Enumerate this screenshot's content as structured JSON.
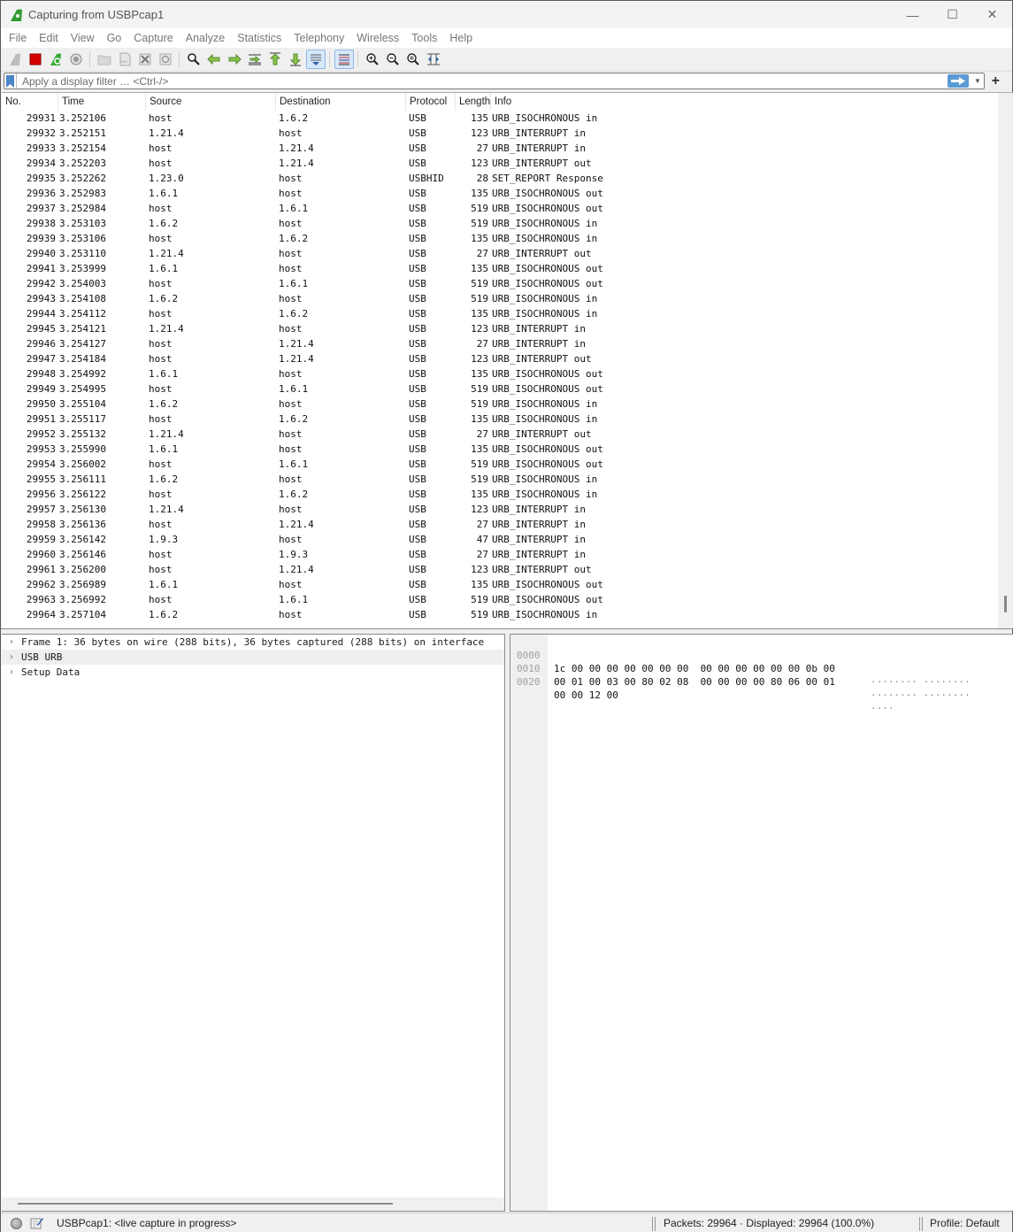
{
  "window": {
    "title": "Capturing from USBPcap1",
    "controls": {
      "minimize": "—",
      "maximize": "☐",
      "close": "✕"
    }
  },
  "menu": [
    "File",
    "Edit",
    "View",
    "Go",
    "Capture",
    "Analyze",
    "Statistics",
    "Telephony",
    "Wireless",
    "Tools",
    "Help"
  ],
  "toolbar": {
    "icons": [
      "start-capture-icon",
      "stop-capture-icon",
      "restart-capture-icon",
      "capture-options-icon",
      "open-file-icon",
      "save-file-icon",
      "close-file-icon",
      "reload-file-icon",
      "find-packet-icon",
      "go-back-icon",
      "go-forward-icon",
      "go-to-packet-icon",
      "first-packet-icon",
      "last-packet-icon",
      "auto-scroll-icon",
      "colorize-icon",
      "zoom-in-icon",
      "zoom-out-icon",
      "normal-size-icon",
      "resize-columns-icon"
    ]
  },
  "filter": {
    "placeholder": "Apply a display filter … <Ctrl-/>",
    "value": "",
    "add_label": "+"
  },
  "packet_list": {
    "columns": [
      "No.",
      "Time",
      "Source",
      "Destination",
      "Protocol",
      "Length",
      "Info"
    ],
    "rows": [
      {
        "no": "29931",
        "time": "3.252106",
        "src": "host",
        "dst": "1.6.2",
        "proto": "USB",
        "len": "135",
        "info": "URB_ISOCHRONOUS in"
      },
      {
        "no": "29932",
        "time": "3.252151",
        "src": "1.21.4",
        "dst": "host",
        "proto": "USB",
        "len": "123",
        "info": "URB_INTERRUPT in"
      },
      {
        "no": "29933",
        "time": "3.252154",
        "src": "host",
        "dst": "1.21.4",
        "proto": "USB",
        "len": "27",
        "info": "URB_INTERRUPT in"
      },
      {
        "no": "29934",
        "time": "3.252203",
        "src": "host",
        "dst": "1.21.4",
        "proto": "USB",
        "len": "123",
        "info": "URB_INTERRUPT out"
      },
      {
        "no": "29935",
        "time": "3.252262",
        "src": "1.23.0",
        "dst": "host",
        "proto": "USBHID",
        "len": "28",
        "info": "SET_REPORT Response"
      },
      {
        "no": "29936",
        "time": "3.252983",
        "src": "1.6.1",
        "dst": "host",
        "proto": "USB",
        "len": "135",
        "info": "URB_ISOCHRONOUS out"
      },
      {
        "no": "29937",
        "time": "3.252984",
        "src": "host",
        "dst": "1.6.1",
        "proto": "USB",
        "len": "519",
        "info": "URB_ISOCHRONOUS out"
      },
      {
        "no": "29938",
        "time": "3.253103",
        "src": "1.6.2",
        "dst": "host",
        "proto": "USB",
        "len": "519",
        "info": "URB_ISOCHRONOUS in"
      },
      {
        "no": "29939",
        "time": "3.253106",
        "src": "host",
        "dst": "1.6.2",
        "proto": "USB",
        "len": "135",
        "info": "URB_ISOCHRONOUS in"
      },
      {
        "no": "29940",
        "time": "3.253110",
        "src": "1.21.4",
        "dst": "host",
        "proto": "USB",
        "len": "27",
        "info": "URB_INTERRUPT out"
      },
      {
        "no": "29941",
        "time": "3.253999",
        "src": "1.6.1",
        "dst": "host",
        "proto": "USB",
        "len": "135",
        "info": "URB_ISOCHRONOUS out"
      },
      {
        "no": "29942",
        "time": "3.254003",
        "src": "host",
        "dst": "1.6.1",
        "proto": "USB",
        "len": "519",
        "info": "URB_ISOCHRONOUS out"
      },
      {
        "no": "29943",
        "time": "3.254108",
        "src": "1.6.2",
        "dst": "host",
        "proto": "USB",
        "len": "519",
        "info": "URB_ISOCHRONOUS in"
      },
      {
        "no": "29944",
        "time": "3.254112",
        "src": "host",
        "dst": "1.6.2",
        "proto": "USB",
        "len": "135",
        "info": "URB_ISOCHRONOUS in"
      },
      {
        "no": "29945",
        "time": "3.254121",
        "src": "1.21.4",
        "dst": "host",
        "proto": "USB",
        "len": "123",
        "info": "URB_INTERRUPT in"
      },
      {
        "no": "29946",
        "time": "3.254127",
        "src": "host",
        "dst": "1.21.4",
        "proto": "USB",
        "len": "27",
        "info": "URB_INTERRUPT in"
      },
      {
        "no": "29947",
        "time": "3.254184",
        "src": "host",
        "dst": "1.21.4",
        "proto": "USB",
        "len": "123",
        "info": "URB_INTERRUPT out"
      },
      {
        "no": "29948",
        "time": "3.254992",
        "src": "1.6.1",
        "dst": "host",
        "proto": "USB",
        "len": "135",
        "info": "URB_ISOCHRONOUS out"
      },
      {
        "no": "29949",
        "time": "3.254995",
        "src": "host",
        "dst": "1.6.1",
        "proto": "USB",
        "len": "519",
        "info": "URB_ISOCHRONOUS out"
      },
      {
        "no": "29950",
        "time": "3.255104",
        "src": "1.6.2",
        "dst": "host",
        "proto": "USB",
        "len": "519",
        "info": "URB_ISOCHRONOUS in"
      },
      {
        "no": "29951",
        "time": "3.255117",
        "src": "host",
        "dst": "1.6.2",
        "proto": "USB",
        "len": "135",
        "info": "URB_ISOCHRONOUS in"
      },
      {
        "no": "29952",
        "time": "3.255132",
        "src": "1.21.4",
        "dst": "host",
        "proto": "USB",
        "len": "27",
        "info": "URB_INTERRUPT out"
      },
      {
        "no": "29953",
        "time": "3.255990",
        "src": "1.6.1",
        "dst": "host",
        "proto": "USB",
        "len": "135",
        "info": "URB_ISOCHRONOUS out"
      },
      {
        "no": "29954",
        "time": "3.256002",
        "src": "host",
        "dst": "1.6.1",
        "proto": "USB",
        "len": "519",
        "info": "URB_ISOCHRONOUS out"
      },
      {
        "no": "29955",
        "time": "3.256111",
        "src": "1.6.2",
        "dst": "host",
        "proto": "USB",
        "len": "519",
        "info": "URB_ISOCHRONOUS in"
      },
      {
        "no": "29956",
        "time": "3.256122",
        "src": "host",
        "dst": "1.6.2",
        "proto": "USB",
        "len": "135",
        "info": "URB_ISOCHRONOUS in"
      },
      {
        "no": "29957",
        "time": "3.256130",
        "src": "1.21.4",
        "dst": "host",
        "proto": "USB",
        "len": "123",
        "info": "URB_INTERRUPT in"
      },
      {
        "no": "29958",
        "time": "3.256136",
        "src": "host",
        "dst": "1.21.4",
        "proto": "USB",
        "len": "27",
        "info": "URB_INTERRUPT in"
      },
      {
        "no": "29959",
        "time": "3.256142",
        "src": "1.9.3",
        "dst": "host",
        "proto": "USB",
        "len": "47",
        "info": "URB_INTERRUPT in"
      },
      {
        "no": "29960",
        "time": "3.256146",
        "src": "host",
        "dst": "1.9.3",
        "proto": "USB",
        "len": "27",
        "info": "URB_INTERRUPT in"
      },
      {
        "no": "29961",
        "time": "3.256200",
        "src": "host",
        "dst": "1.21.4",
        "proto": "USB",
        "len": "123",
        "info": "URB_INTERRUPT out"
      },
      {
        "no": "29962",
        "time": "3.256989",
        "src": "1.6.1",
        "dst": "host",
        "proto": "USB",
        "len": "135",
        "info": "URB_ISOCHRONOUS out"
      },
      {
        "no": "29963",
        "time": "3.256992",
        "src": "host",
        "dst": "1.6.1",
        "proto": "USB",
        "len": "519",
        "info": "URB_ISOCHRONOUS out"
      },
      {
        "no": "29964",
        "time": "3.257104",
        "src": "1.6.2",
        "dst": "host",
        "proto": "USB",
        "len": "519",
        "info": "URB_ISOCHRONOUS in"
      }
    ]
  },
  "details": {
    "items": [
      {
        "label": "Frame 1: 36 bytes on wire (288 bits), 36 bytes captured (288 bits) on interface",
        "expander": "›"
      },
      {
        "label": "USB URB",
        "expander": "›"
      },
      {
        "label": "Setup Data",
        "expander": "›"
      }
    ]
  },
  "bytes": {
    "rows": [
      {
        "offset": "0000",
        "hex": "1c 00 00 00 00 00 00 00  00 00 00 00 00 00 0b 00",
        "ascii": "········ ········"
      },
      {
        "offset": "0010",
        "hex": "00 01 00 03 00 80 02 08  00 00 00 00 80 06 00 01",
        "ascii": "········ ········"
      },
      {
        "offset": "0020",
        "hex": "00 00 12 00",
        "ascii": "····"
      }
    ]
  },
  "status": {
    "capture_text": "USBPcap1: <live capture in progress>",
    "packets_text": "Packets: 29964 · Displayed: 29964 (100.0%)",
    "profile_text": "Profile: Default"
  }
}
